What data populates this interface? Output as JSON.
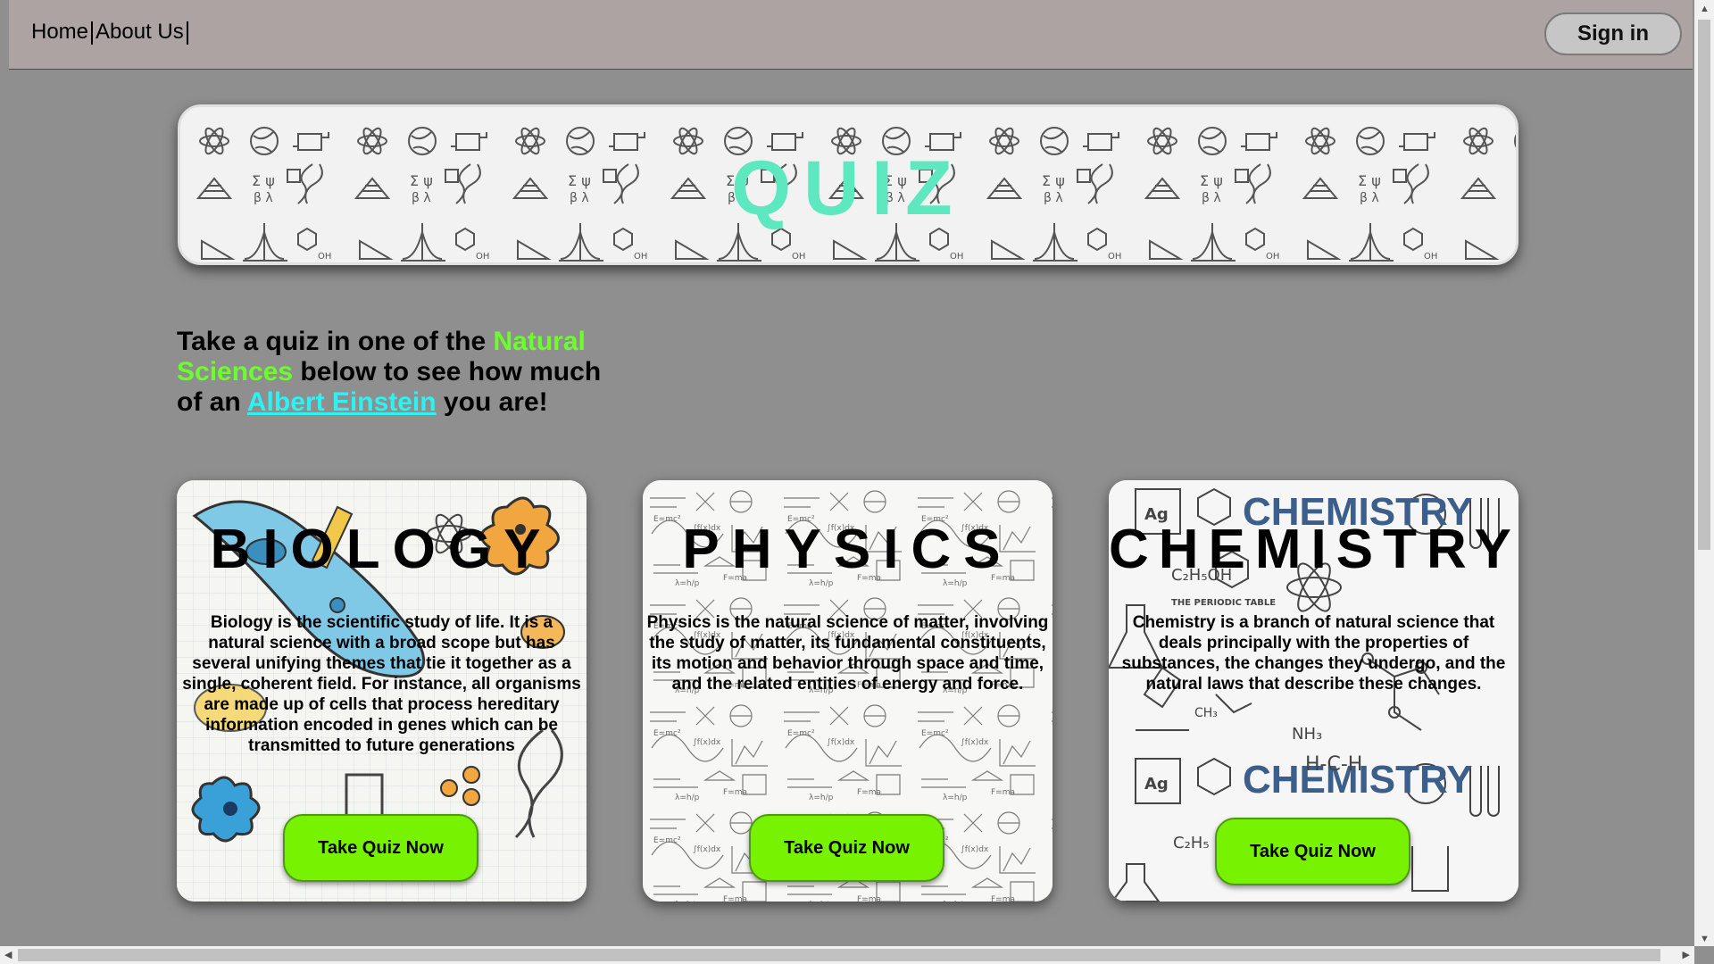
{
  "nav": {
    "home": "Home",
    "about": "About Us",
    "sign_in": "Sign in"
  },
  "banner": {
    "title": "QUIZ"
  },
  "intro": {
    "part1": "Take a quiz in one of the ",
    "highlight": "Natural Sciences",
    "part2": " below to see how much of an ",
    "link": "Albert Einstein",
    "part3": " you are!"
  },
  "cards": [
    {
      "title": "BIOLOGY",
      "description": "Biology is the scientific study of life. It is a natural science with a broad scope but has several unifying themes that tie it together as a single, coherent field. For instance, all organisms are made up of cells that process hereditary information encoded in genes which can be transmitted to future generations",
      "button": "Take Quiz Now"
    },
    {
      "title": "PHYSICS",
      "description": "Physics is the natural science of matter, involving the study of matter, its fundamental constituents, its motion and behavior through space and time, and the related entities of energy and force.",
      "button": "Take Quiz Now"
    },
    {
      "title": "CHEMISTRY",
      "description": "Chemistry is a branch of natural science that deals principally with the properties of substances, the changes they undergo, and the natural laws that describe these changes.",
      "button": "Take Quiz Now"
    }
  ],
  "colors": {
    "background": "#8f8f8f",
    "navbar": "#ada3a3",
    "quiz_title": "#5de8c0",
    "highlight_green": "#6dff2b",
    "link_cyan": "#2ef2f2",
    "button_green": "#77f200"
  }
}
